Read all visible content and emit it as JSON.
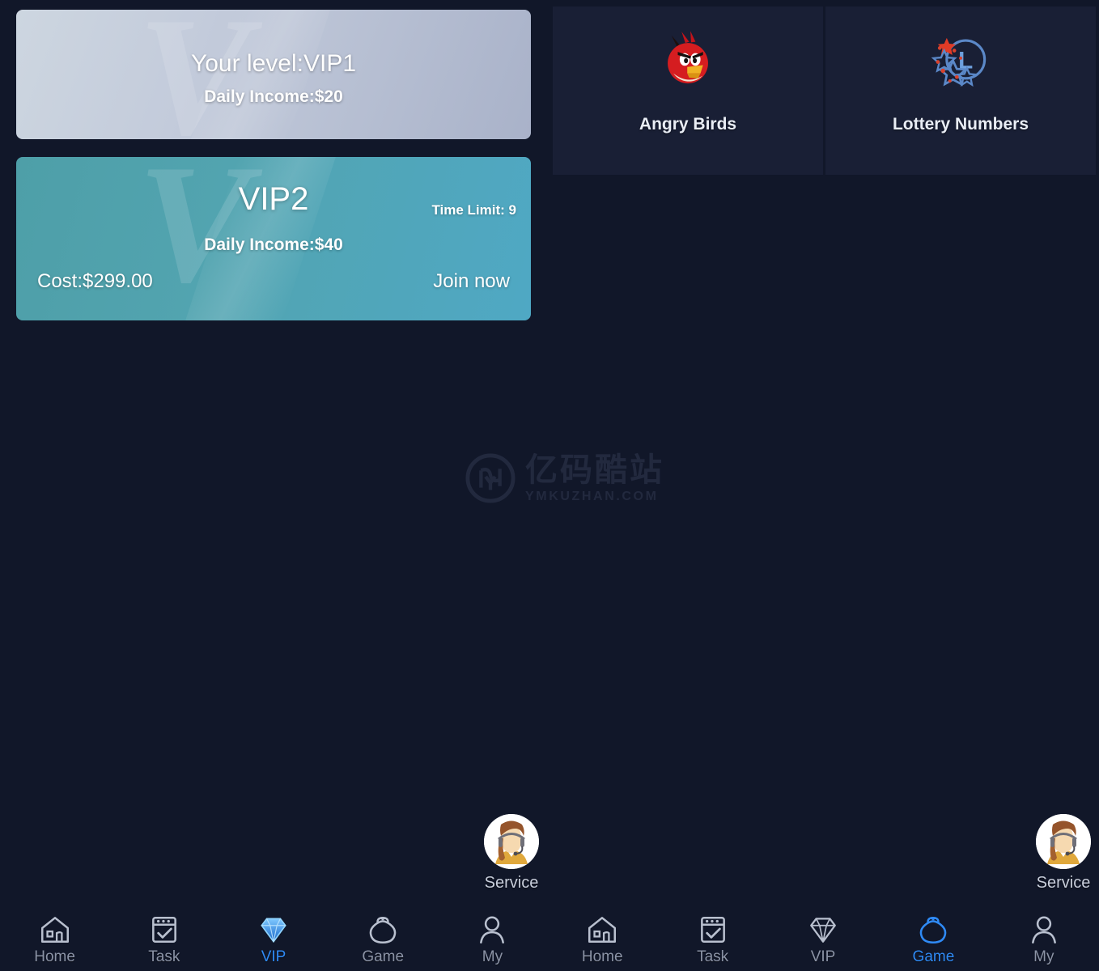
{
  "theme": {
    "background": "#111729",
    "card_background": "#191f35",
    "accent": "#2f8af5",
    "vip_current_gradient_start": "#cdd6e0",
    "vip_current_gradient_end": "#a9b2c9",
    "vip_offer_gradient_start": "#4e9fa8",
    "vip_offer_gradient_end": "#4fa8c4",
    "text_primary": "#ffffff",
    "text_muted": "#8b93a6"
  },
  "vip": {
    "current": {
      "level_text": "Your level:VIP1",
      "income_text": "Daily Income:$20"
    },
    "offer": {
      "name": "VIP2",
      "time_limit": "Time Limit: 9",
      "income_text": "Daily Income:$40",
      "cost_text": "Cost:$299.00",
      "join_label": "Join now"
    }
  },
  "games": [
    {
      "label": "Angry Birds",
      "icon": "angry-bird-icon"
    },
    {
      "label": "Lottery Numbers",
      "icon": "lottery-ball-icon"
    }
  ],
  "watermark": {
    "chinese": "亿码酷站",
    "english": "YMKUZHAN.COM",
    "logo": "ym-circle-logo"
  },
  "service": {
    "label": "Service",
    "icon": "headset-agent-avatar"
  },
  "nav_left": {
    "items": [
      {
        "label": "Home",
        "icon": "home-icon",
        "active": false
      },
      {
        "label": "Task",
        "icon": "task-icon",
        "active": false
      },
      {
        "label": "VIP",
        "icon": "diamond-icon",
        "active": true
      },
      {
        "label": "Game",
        "icon": "pouch-icon",
        "active": false
      },
      {
        "label": "My",
        "icon": "person-icon",
        "active": false
      }
    ]
  },
  "nav_right": {
    "items": [
      {
        "label": "Home",
        "icon": "home-icon",
        "active": false
      },
      {
        "label": "Task",
        "icon": "task-icon",
        "active": false
      },
      {
        "label": "VIP",
        "icon": "diamond-icon",
        "active": false
      },
      {
        "label": "Game",
        "icon": "pouch-icon",
        "active": true
      },
      {
        "label": "My",
        "icon": "person-icon",
        "active": false
      }
    ]
  }
}
